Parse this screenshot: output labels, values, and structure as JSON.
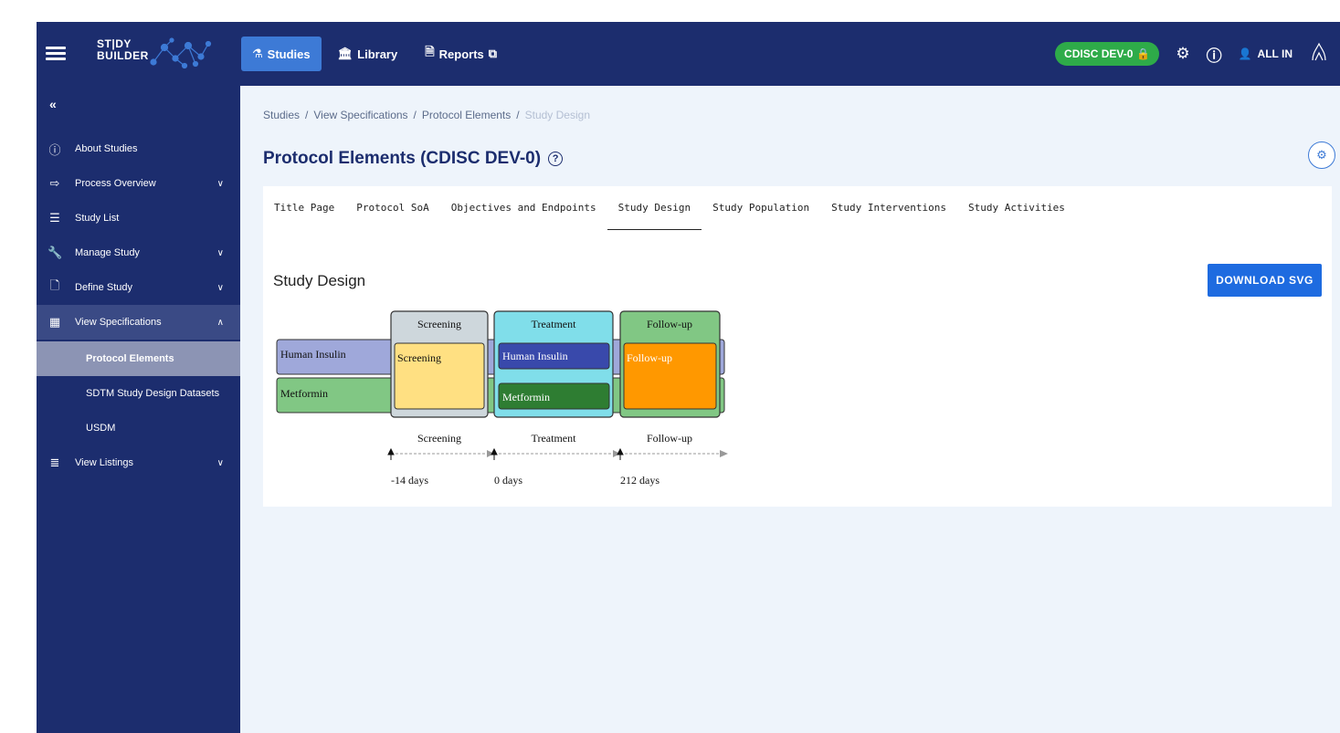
{
  "app": {
    "logo_line1": "ST|DY",
    "logo_line2": "BUILDER"
  },
  "topnav": {
    "tabs": [
      {
        "label": "Studies",
        "icon": "flask-icon"
      },
      {
        "label": "Library",
        "icon": "library-icon"
      },
      {
        "label": "Reports",
        "icon": "reports-icon"
      }
    ],
    "study_chip": "CDISC DEV-0",
    "user": "ALL IN"
  },
  "sidebar": {
    "items": [
      {
        "label": "About Studies",
        "icon": "info-icon"
      },
      {
        "label": "Process Overview",
        "icon": "arrow-right-icon"
      },
      {
        "label": "Study List",
        "icon": "list-icon"
      },
      {
        "label": "Manage Study",
        "icon": "wrench-icon"
      },
      {
        "label": "Define Study",
        "icon": "document-edit-icon"
      },
      {
        "label": "View Specifications",
        "icon": "grid-icon"
      },
      {
        "label": "View Listings",
        "icon": "listings-icon"
      }
    ],
    "subitems": [
      {
        "label": "Protocol Elements",
        "active": true
      },
      {
        "label": "SDTM Study Design Datasets",
        "active": false
      },
      {
        "label": "USDM",
        "active": false
      }
    ]
  },
  "breadcrumb": [
    "Studies",
    "View Specifications",
    "Protocol Elements",
    "Study Design"
  ],
  "page": {
    "title": "Protocol Elements (CDISC DEV-0)"
  },
  "tabs": [
    "Title Page",
    "Protocol SoA",
    "Objectives and Endpoints",
    "Study Design",
    "Study Population",
    "Study Interventions",
    "Study Activities"
  ],
  "active_tab": "Study Design",
  "section": {
    "title": "Study Design",
    "download_label": "DOWNLOAD SVG"
  },
  "design": {
    "arms": [
      "Human Insulin",
      "Metformin"
    ],
    "epochs": [
      {
        "label": "Screening",
        "element": "Screening",
        "color": "#ffe082",
        "header_color": "#ced7dc"
      },
      {
        "label": "Treatment",
        "element": "",
        "color": "#80deea",
        "header_color": "#80deea"
      },
      {
        "label": "Follow-up",
        "element": "Follow-up",
        "color": "#ff9800",
        "header_color": "#81c784"
      }
    ],
    "treatment_elements": [
      "Human Insulin",
      "Metformin"
    ],
    "timeline": {
      "labels": [
        "Screening",
        "Treatment",
        "Follow-up"
      ],
      "days": [
        "-14 days",
        "0 days",
        "212 days"
      ]
    }
  }
}
